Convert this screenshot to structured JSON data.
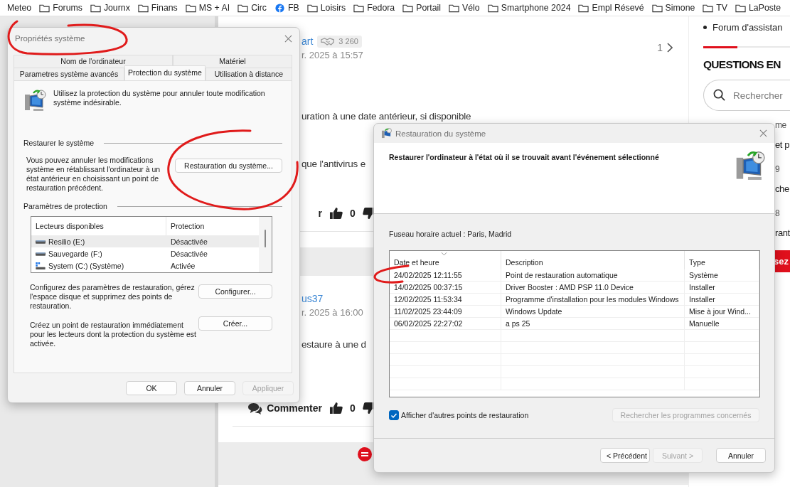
{
  "bookmarks": [
    {
      "label": "Meteo",
      "kind": "text"
    },
    {
      "label": "Forums",
      "kind": "folder"
    },
    {
      "label": "Journx",
      "kind": "folder"
    },
    {
      "label": "Finans",
      "kind": "folder"
    },
    {
      "label": "MS + AI",
      "kind": "folder"
    },
    {
      "label": "Circ",
      "kind": "folder"
    },
    {
      "label": "FB",
      "kind": "facebook"
    },
    {
      "label": "Loisirs",
      "kind": "folder"
    },
    {
      "label": "Fedora",
      "kind": "folder"
    },
    {
      "label": "Portail",
      "kind": "folder"
    },
    {
      "label": "Vélo",
      "kind": "folder"
    },
    {
      "label": "Smartphone 2024",
      "kind": "folder"
    },
    {
      "label": "Empl Résevé",
      "kind": "folder"
    },
    {
      "label": "Simone",
      "kind": "folder"
    },
    {
      "label": "TV",
      "kind": "folder"
    },
    {
      "label": "LaPoste",
      "kind": "folder"
    }
  ],
  "page": {
    "pager": "1",
    "posts": [
      {
        "author": "art",
        "badge": "3 260",
        "date": "r. 2025 à 15:57",
        "paragraphs": [
          "uration à une date antérieur, si disponible",
          "que l'antivirus e"
        ],
        "comment_icon": false,
        "comment": "r",
        "votes": "0"
      },
      {
        "author": "us37",
        "date": "r. 2025 à 16:00",
        "paragraphs": [
          "estaure à une d"
        ],
        "comment_icon": true,
        "comment": "Commenter",
        "votes": "0"
      }
    ]
  },
  "sidebar": {
    "bullet_link": "Forum d'assistan",
    "heading": "QUESTIONS EN",
    "search_placeholder": "Rechercher",
    "fragments": [
      {
        "text": "me",
        "kind": "meta"
      },
      {
        "text": "et p",
        "kind": "title"
      },
      {
        "text": "9",
        "kind": "meta"
      },
      {
        "text": "che",
        "kind": "title"
      },
      {
        "text": "8",
        "kind": "meta"
      },
      {
        "text": "rant",
        "kind": "title"
      }
    ],
    "button": "sez"
  },
  "system_properties": {
    "title": "Propriétés système",
    "tab_rows": [
      [
        {
          "label": "Nom de l'ordinateur",
          "selected": false
        },
        {
          "label": "Matériel",
          "selected": false
        }
      ],
      [
        {
          "label": "Parametres système avancés",
          "selected": false
        },
        {
          "label": "Protection du système",
          "selected": true
        },
        {
          "label": "Utilisation à distance",
          "selected": false
        }
      ]
    ],
    "intro": "Utilisez la protection du système pour annuler toute modification système indésirable.",
    "restore_group": {
      "title": "Restaurer le système",
      "text": "Vous pouvez annuler les modifications système en rétablissant l'ordinateur à un état antérieur en choisissant un point de restauration précédent.",
      "button": "Restauration du système..."
    },
    "protection_group": {
      "title": "Paramètres de protection",
      "columns": [
        "Lecteurs disponibles",
        "Protection"
      ],
      "drives": [
        {
          "name": "Resilio (E:)",
          "protection": "Désactivée",
          "kind": "drive",
          "selected": true
        },
        {
          "name": "Sauvegarde (F:)",
          "protection": "Désactivée",
          "kind": "drive",
          "selected": false
        },
        {
          "name": "System (C:) (Système)",
          "protection": "Activée",
          "kind": "system",
          "selected": false
        }
      ],
      "configure_text": "Configurez des paramètres de restauration, gérez l'espace disque et supprimez des points de restauration.",
      "configure_button": "Configurer...",
      "create_text": "Créez un point de restauration immédiatement pour les lecteurs dont la protection du système est activée.",
      "create_button": "Créer..."
    },
    "buttons": [
      {
        "label": "OK",
        "disabled": false
      },
      {
        "label": "Annuler",
        "disabled": false
      },
      {
        "label": "Appliquer",
        "disabled": true
      }
    ]
  },
  "system_restore": {
    "title": "Restauration du système",
    "heading": "Restaurer l'ordinateur à l'état où il se trouvait avant l'événement sélectionné",
    "timezone": "Fuseau horaire actuel : Paris, Madrid",
    "columns": [
      {
        "label": "Date et heure",
        "sorted": true
      },
      {
        "label": "Description",
        "sorted": false
      },
      {
        "label": "Type",
        "sorted": false
      }
    ],
    "rows": [
      {
        "date": "24/02/2025 12:11:55",
        "description": "Point de restauration automatique",
        "type": "Système"
      },
      {
        "date": "14/02/2025 00:37:15",
        "description": "Driver Booster : AMD PSP 11.0 Device",
        "type": "Installer"
      },
      {
        "date": "12/02/2025 11:53:34",
        "description": "Programme d'installation pour les modules Windows",
        "type": "Installer"
      },
      {
        "date": "11/02/2025 23:44:09",
        "description": "Windows Update",
        "type": "Mise à jour Wind..."
      },
      {
        "date": "06/02/2025 22:27:02",
        "description": "a ps 25",
        "type": "Manuelle"
      }
    ],
    "show_more": {
      "label": "Afficher d'autres points de restauration",
      "checked": true
    },
    "scan_button": {
      "label": "Rechercher les programmes concernés",
      "disabled": true
    },
    "buttons": [
      {
        "label": "< Précédent",
        "disabled": false
      },
      {
        "label": "Suivant >",
        "disabled": true
      },
      {
        "label": "Annuler",
        "disabled": false
      }
    ]
  }
}
